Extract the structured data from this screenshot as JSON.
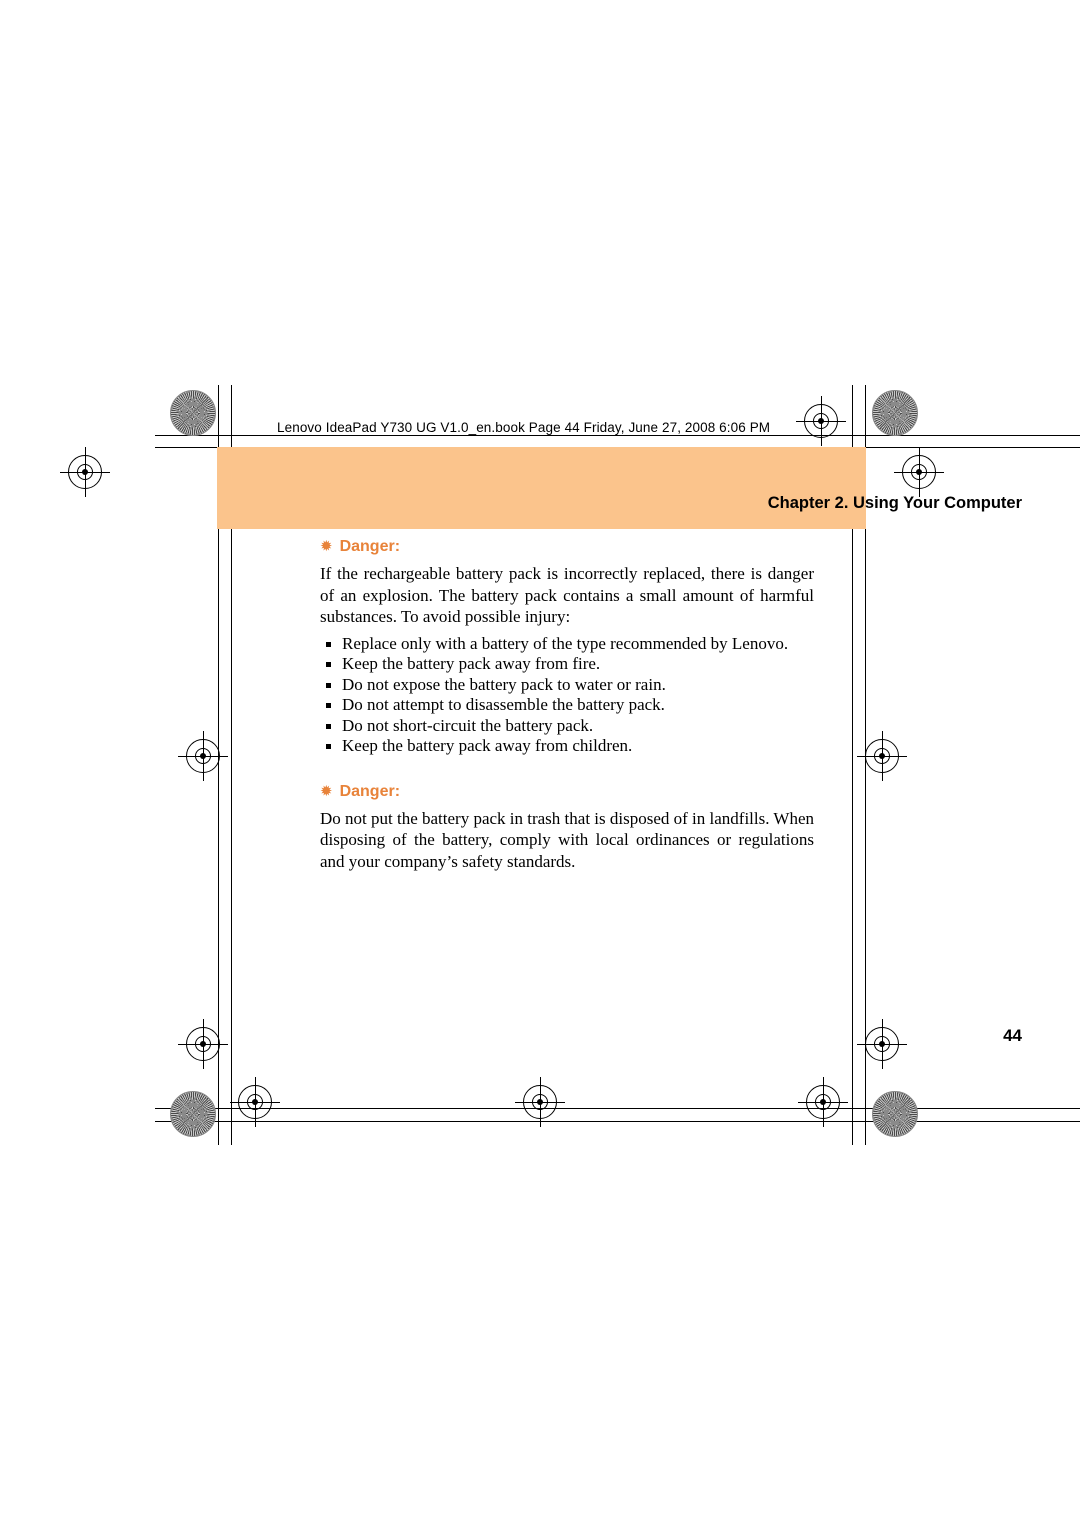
{
  "document": {
    "filepath_line": "Lenovo IdeaPad Y730 UG V1.0_en.book  Page 44  Friday, June 27, 2008  6:06 PM",
    "chapter_header": "Chapter 2. Using Your Computer",
    "page_number": "44",
    "accent_color": "#e8833a",
    "header_band_color": "#fbc48c"
  },
  "sections": [
    {
      "icon": "danger-star-icon",
      "label": "Danger:",
      "paragraphs": [
        "If the rechargeable battery pack is incorrectly replaced, there is danger of an explosion. The battery pack contains a small amount of harmful substances. To avoid possible injury:"
      ],
      "bullets": [
        "Replace only with a battery of the type recommended by Lenovo.",
        "Keep the battery pack away from fire.",
        "Do not expose the battery pack to water or rain.",
        "Do not attempt to disassemble the battery pack.",
        "Do not short-circuit the battery pack.",
        "Keep the battery pack away from children."
      ]
    },
    {
      "icon": "danger-star-icon",
      "label": "Danger:",
      "paragraphs": [
        "Do not put the battery pack in trash that is disposed of in landfills. When disposing of the battery, comply with local ordinances or regulations and your company’s safety standards."
      ],
      "bullets": []
    }
  ]
}
